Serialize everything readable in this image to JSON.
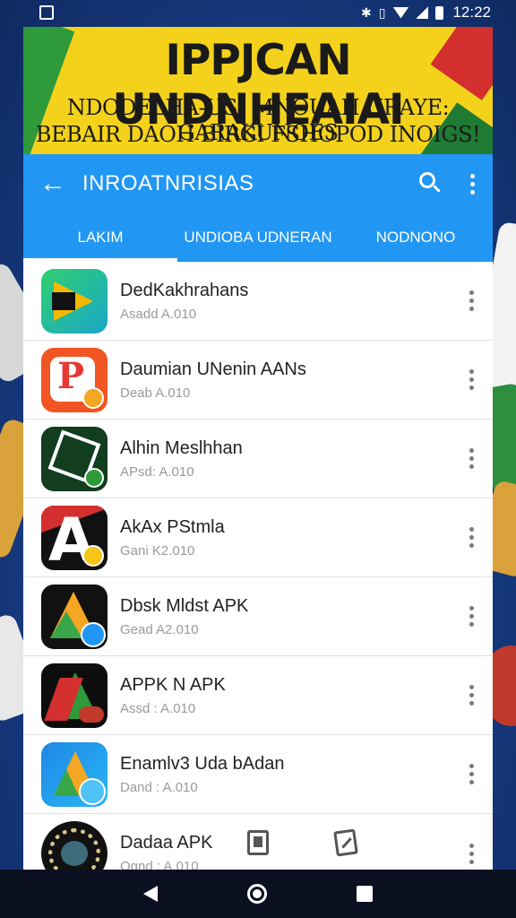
{
  "status_bar": {
    "time": "12:22"
  },
  "banner": {
    "title": "IPPJCAN UNDNHEAIAI",
    "line1": "NDODELHA-USI MNOUAH URAYE: GARAKUNOES",
    "line2": "BEBAIR DAOH BIRGI FSHOPOD INOIGS!"
  },
  "toolbar": {
    "back_label": "←",
    "title": "INROATNRISIAS"
  },
  "tabs": [
    {
      "label": "LAKIM"
    },
    {
      "label": "UNDIOBA UDNERAN"
    },
    {
      "label": "NODNONO"
    }
  ],
  "apps": [
    {
      "name": "DedKakhrahans",
      "meta": "Asadd A.010"
    },
    {
      "name": "Daumian UNenin AANs",
      "meta": "Deab A.010"
    },
    {
      "name": "Alhin Meslhhan",
      "meta": "APsd: A.010"
    },
    {
      "name": "AkAx PStmla",
      "meta": "Gani K2.010"
    },
    {
      "name": "Dbsk Mldst APK",
      "meta": "Gead A2.010"
    },
    {
      "name": "APPK N APK",
      "meta": "Assd : A.010"
    },
    {
      "name": "Enamlv3 Uda bAdan",
      "meta": "Dand : A.010"
    },
    {
      "name": "Dadaa APK",
      "meta": "Ognd : A.010"
    }
  ],
  "colors": {
    "primary": "#2196f3",
    "banner_yellow": "#f4d21c",
    "banner_red": "#d32f2f",
    "banner_green": "#2e9a3a"
  }
}
